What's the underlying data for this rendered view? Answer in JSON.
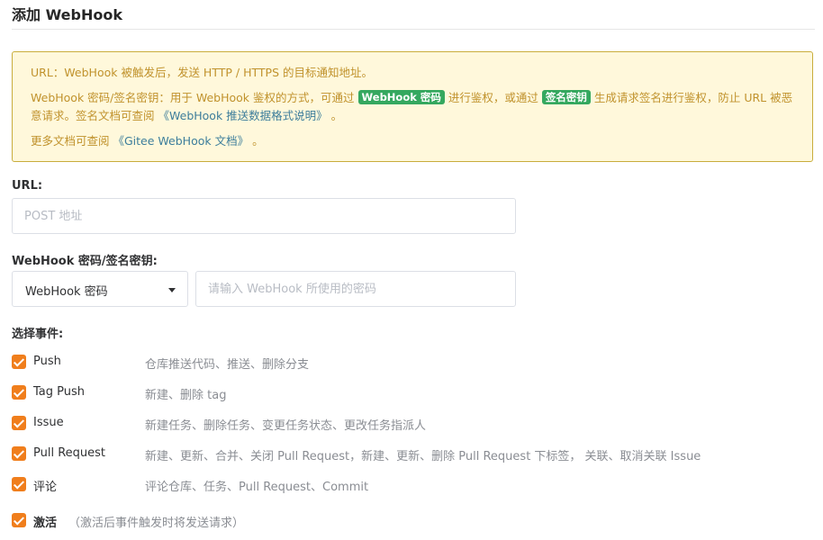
{
  "page": {
    "title": "添加 WebHook"
  },
  "notice": {
    "line1": "URL：WebHook 被触发后，发送 HTTP / HTTPS 的目标通知地址。",
    "line2_part1": "WebHook 密码/签名密钥：用于 WebHook 鉴权的方式，可通过",
    "tag_password": "WebHook 密码",
    "line2_part2": "进行鉴权，或通过",
    "tag_signature": "签名密钥",
    "line2_part3": "生成请求签名进行鉴权，防止 URL 被恶意请求。签名文档可查阅",
    "link_push_format": "《WebHook 推送数据格式说明》",
    "line2_end": "。",
    "line3_part1": "更多文档可查阅",
    "link_gitee_docs": "《Gitee WebHook 文档》",
    "line3_end": "。"
  },
  "url_field": {
    "label": "URL:",
    "placeholder": "POST 地址",
    "value": ""
  },
  "secret_field": {
    "label": "WebHook 密码/签名密钥:",
    "select_value": "WebHook 密码",
    "placeholder": "请输入 WebHook 所使用的密码",
    "value": ""
  },
  "events": {
    "label": "选择事件:",
    "items": [
      {
        "name": "Push",
        "description": "仓库推送代码、推送、删除分支",
        "checked": true
      },
      {
        "name": "Tag Push",
        "description": "新建、删除 tag",
        "checked": true
      },
      {
        "name": "Issue",
        "description": "新建任务、删除任务、变更任务状态、更改任务指派人",
        "checked": true
      },
      {
        "name": "Pull Request",
        "description": "新建、更新、合并、关闭 Pull Request，新建、更新、删除 Pull Request 下标签， 关联、取消关联 Issue",
        "checked": true
      },
      {
        "name": "评论",
        "description": "评论仓库、任务、Pull Request、Commit",
        "checked": true
      }
    ]
  },
  "activate": {
    "label": "激活",
    "hint": "（激活后事件触发时将发送请求）",
    "checked": true
  },
  "colors": {
    "checkbox": "#f07e1c",
    "notice_bg": "#fff8db",
    "notice_text": "#c0922c",
    "tag_bg": "#35a85f"
  }
}
